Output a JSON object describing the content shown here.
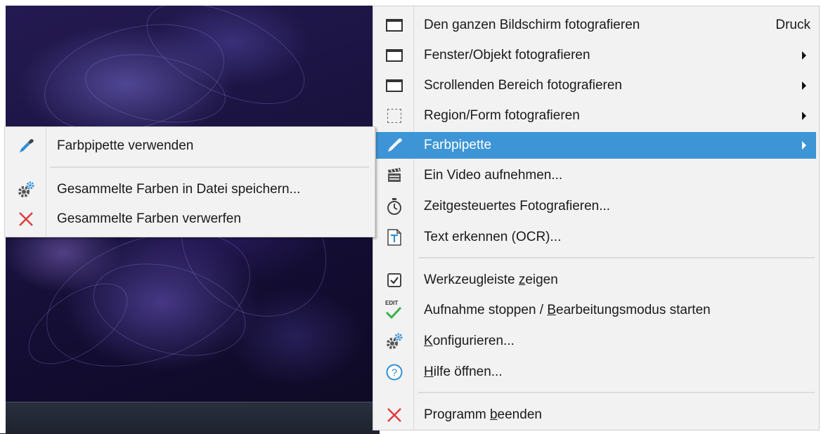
{
  "menu": {
    "items": [
      {
        "label": "Den ganzen Bildschirm fotografieren",
        "shortcut": "Druck",
        "icon": "window-icon"
      },
      {
        "label": "Fenster/Objekt fotografieren",
        "icon": "window-icon"
      },
      {
        "label": "Scrollenden Bereich fotografieren",
        "icon": "window-icon"
      },
      {
        "label": "Region/Form fotografieren",
        "icon": "region-icon"
      },
      {
        "label": "Farbpipette",
        "icon": "eyedropper-icon",
        "highlighted": true
      },
      {
        "label": "Ein Video aufnehmen...",
        "icon": "clapperboard-icon"
      },
      {
        "label": "Zeitgesteuertes Fotografieren...",
        "icon": "stopwatch-icon"
      },
      {
        "label": "Text erkennen (OCR)...",
        "icon": "text-document-icon"
      },
      {
        "label_pre": "Werkzeugleiste ",
        "label_u": "z",
        "label_post": "eigen",
        "icon": "checkbox-icon"
      },
      {
        "label_pre": "Aufnahme stoppen / ",
        "label_u": "B",
        "label_post": "earbeitungsmodus starten",
        "icon": "edit-check-icon",
        "icon_text": "EDIT"
      },
      {
        "label_pre": "",
        "label_u": "K",
        "label_post": "onfigurieren...",
        "icon": "gears-icon"
      },
      {
        "label_pre": "",
        "label_u": "H",
        "label_post": "ilfe öffnen...",
        "icon": "help-icon"
      },
      {
        "label_pre": "Programm ",
        "label_u": "b",
        "label_post": "eenden",
        "icon": "close-x-icon"
      }
    ]
  },
  "submenu": {
    "items": [
      {
        "label": "Farbpipette verwenden",
        "icon": "eyedropper-icon"
      },
      {
        "label": "Gesammelte Farben in Datei speichern...",
        "icon": "gears-icon"
      },
      {
        "label": "Gesammelte Farben verwerfen",
        "icon": "close-x-icon"
      }
    ]
  },
  "colors": {
    "highlight": "#3d95d6",
    "menu_bg": "#f2f2f2",
    "close_red": "#e03a3a",
    "help_blue": "#2f8fd8",
    "check_green": "#3ab04a"
  }
}
